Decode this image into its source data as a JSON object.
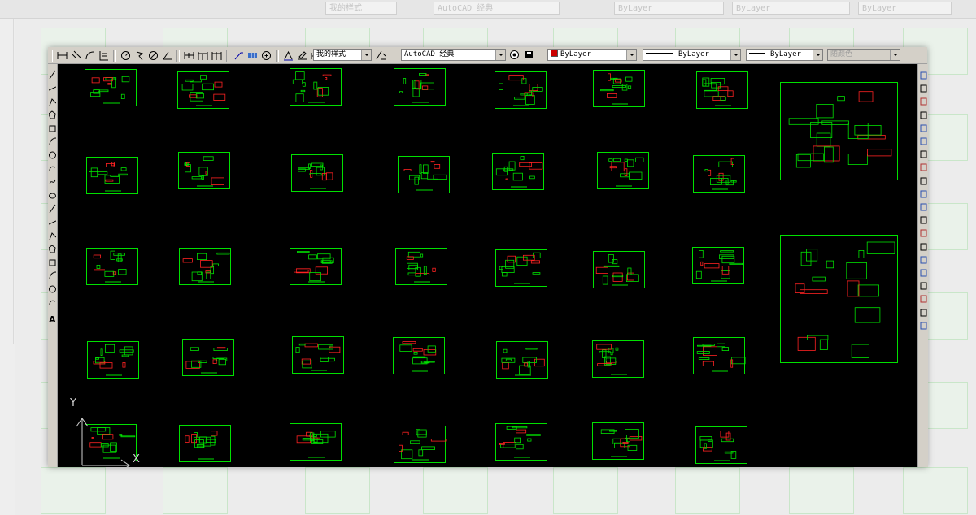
{
  "toolbar": {
    "text_style": "我的样式",
    "workspace": "AutoCAD 经典",
    "color": "ByLayer",
    "linetype": "ByLayer",
    "lineweight": "ByLayer",
    "plotstyle": "随颜色"
  },
  "background": {
    "text_style": "我的样式",
    "workspace": "AutoCAD 经典",
    "color": "ByLayer",
    "linetype": "ByLayer",
    "lineweight": "ByLayer"
  },
  "canvas": {
    "background_color": "#000000",
    "sheet_color": "#00e000",
    "accent_color": "#ff2222",
    "sheet_grid": {
      "rows": 5,
      "columns": 7
    }
  },
  "ucs": {
    "y_label": "Y",
    "x_label": "X"
  },
  "left_tools": {
    "icons": [
      "line-icon",
      "construction-line-icon",
      "polyline-icon",
      "polygon-icon",
      "rectangle-icon",
      "arc-icon",
      "circle-icon",
      "revision-cloud-icon",
      "spline-icon",
      "ellipse-icon",
      "ellipse-arc-icon",
      "insert-block-icon",
      "make-block-icon",
      "point-icon",
      "hatch-icon",
      "gradient-icon",
      "region-icon",
      "table-icon"
    ],
    "text_tool": "A"
  },
  "right_tools": {
    "icons": [
      "erase-icon",
      "copy-icon",
      "mirror-icon",
      "offset-icon",
      "array-icon",
      "move-icon",
      "rotate-icon",
      "scale-icon",
      "stretch-icon",
      "trim-icon",
      "extend-icon",
      "break-icon",
      "join-icon",
      "chamfer-icon",
      "fillet-icon",
      "explode-icon",
      "draw-order-icon",
      "properties-icon",
      "layer-icon",
      "match-icon"
    ]
  }
}
